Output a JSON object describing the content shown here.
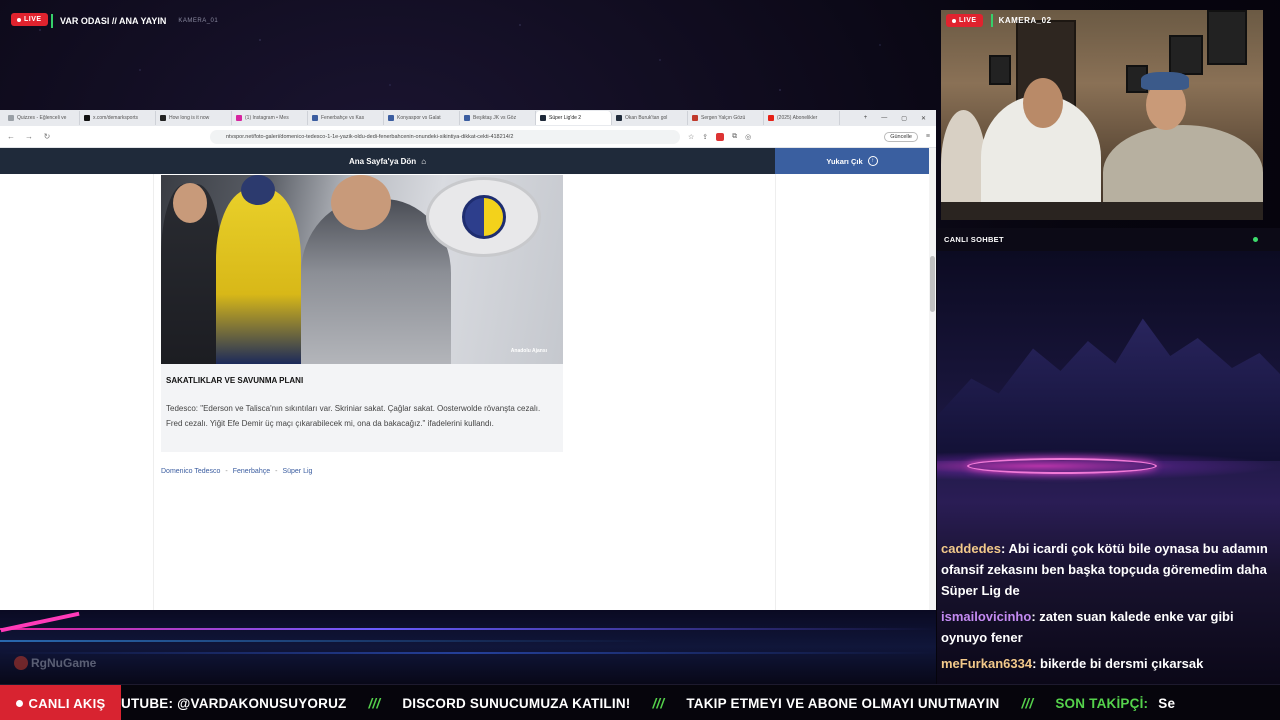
{
  "overlay": {
    "live_badge": "LIVE",
    "title": "VAR ODASI // ANA YAYIN",
    "camera1_label": "KAMERA_01",
    "camera2_label": "KAMERA_02",
    "logo_text": "RgNuGame"
  },
  "browser": {
    "tabs": [
      {
        "label": "Quizzes - Eğlenceli ve",
        "color": "#9aa0a6"
      },
      {
        "label": "x.com/demarksports",
        "color": "#111111"
      },
      {
        "label": "How long is it now",
        "color": "#222222"
      },
      {
        "label": "(1) Instagram • Mes",
        "color": "#d6249f"
      },
      {
        "label": "Fenerbahçe vs Kas",
        "color": "#3b5da0"
      },
      {
        "label": "Konyaspor vs Galat",
        "color": "#3b5da0"
      },
      {
        "label": "Beşiktaş JK vs Göz",
        "color": "#3b5da0"
      },
      {
        "label": "Süper Lig'de 2",
        "color": "#1f2a3a",
        "active": true
      },
      {
        "label": "Okan Buruk'tan gol",
        "color": "#1f2a3a"
      },
      {
        "label": "Sergen Yalçın Gözü",
        "color": "#c0392b"
      },
      {
        "label": "(2025) Abonelikler",
        "color": "#e62117"
      }
    ],
    "url": "ntvspor.net/foto-galeri/domenico-tedesco-1-1e-yazik-oldu-dedi-fenerbahcenin-onundeki-sikintiya-dikkat-cekti-418214/2",
    "update_button": "Güncelle"
  },
  "site": {
    "home_link": "Ana Sayfa'ya Dön",
    "top_link": "Yukarı Çık",
    "photo_credit": "Anadolu Ajansı",
    "section_title": "SAKATLIKLAR VE SAVUNMA PLANI",
    "section_text": "Tedesco: \"Ederson ve Talisca'nın sıkıntıları var. Skriniar sakat. Çağlar sakat. Oosterwolde rövanşta cezalı. Fred cezalı. Yiğit Efe Demir üç maçı çıkarabilecek mi, ona da bakacağız.\" ifadelerini kullandı.",
    "tags": [
      "Domenico Tedesco",
      "Fenerbahçe",
      "Süper Lig"
    ]
  },
  "chat": {
    "header": "CANLI SOHBET",
    "messages": [
      {
        "user": "caddedes",
        "color": "#f2c98a",
        "text": ": Abi icardi çok kötü bile oynasa bu adamın ofansif zekasını ben başka topçuda göremedim daha Süper Lig de"
      },
      {
        "user": "ismailovicinho",
        "color": "#c48af2",
        "text": ": zaten suan kalede enke var gibi oynuyo fener"
      },
      {
        "user": "meFurkan6334",
        "color": "#f2c98a",
        "text": ": bikerde bi dersmi çıkarsak"
      }
    ]
  },
  "ticker": {
    "live_label": "CANLI AKIŞ",
    "items": [
      "UTUBE: @VARDAKONUSUYORUZ",
      "DISCORD SUNUCUMUZA KATILIN!",
      "TAKIP ETMEYI VE ABONE OLMAYI UNUTMAYIN"
    ],
    "separator": "///",
    "last_follower_label": "SON TAKİPÇİ:",
    "last_follower_value": "Se"
  }
}
